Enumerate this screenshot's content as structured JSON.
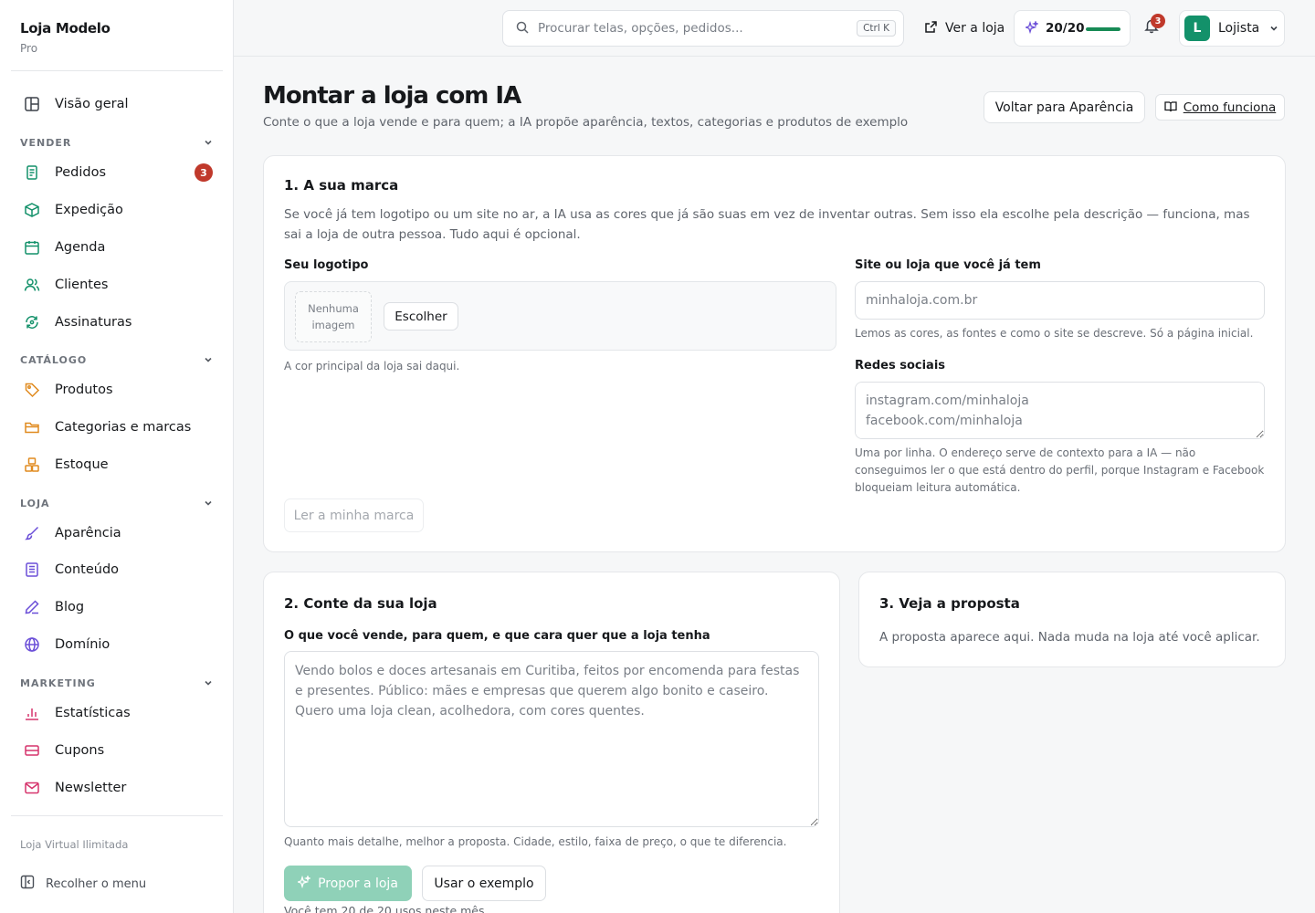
{
  "brand": {
    "name": "Loja Modelo",
    "plan": "Pro"
  },
  "sidebar": {
    "overview": {
      "label": "Visão geral",
      "icon": "layout-icon"
    },
    "sections": [
      {
        "label": "VENDER",
        "items": [
          {
            "label": "Pedidos",
            "icon": "receipt-icon",
            "badge": "3"
          },
          {
            "label": "Expedição",
            "icon": "box-icon"
          },
          {
            "label": "Agenda",
            "icon": "calendar-icon"
          },
          {
            "label": "Clientes",
            "icon": "users-icon"
          },
          {
            "label": "Assinaturas",
            "icon": "refresh-icon"
          }
        ]
      },
      {
        "label": "CATÁLOGO",
        "items": [
          {
            "label": "Produtos",
            "icon": "tag-icon"
          },
          {
            "label": "Categorias e marcas",
            "icon": "folder-icon"
          },
          {
            "label": "Estoque",
            "icon": "boxes-icon"
          }
        ]
      },
      {
        "label": "LOJA",
        "items": [
          {
            "label": "Aparência",
            "icon": "brush-icon"
          },
          {
            "label": "Conteúdo",
            "icon": "document-icon"
          },
          {
            "label": "Blog",
            "icon": "pen-icon"
          },
          {
            "label": "Domínio",
            "icon": "globe-icon"
          }
        ]
      },
      {
        "label": "MARKETING",
        "items": [
          {
            "label": "Estatísticas",
            "icon": "bar-chart-icon"
          },
          {
            "label": "Cupons",
            "icon": "ticket-icon"
          },
          {
            "label": "Newsletter",
            "icon": "mail-icon"
          }
        ]
      }
    ],
    "footer_plan": "Loja Virtual Ilimitada",
    "collapse_label": "Recolher o menu"
  },
  "topbar": {
    "search_placeholder": "Procurar telas, opções, pedidos...",
    "search_shortcut": "Ctrl K",
    "view_store": "Ver a loja",
    "usage_label": "20/20",
    "usage_fraction": 1.0,
    "notifications_count": "3",
    "account_initial": "L",
    "account_name": "Lojista"
  },
  "page": {
    "title": "Montar a loja com IA",
    "subtitle": "Conte o que a loja vende e para quem; a IA propõe aparência, textos, categorias e produtos de exemplo",
    "back_button": "Voltar para Aparência",
    "how_button": "Como funciona"
  },
  "brand_card": {
    "title": "1. A sua marca",
    "intro": "Se você já tem logotipo ou um site no ar, a IA usa as cores que já são suas em vez de inventar outras. Sem isso ela escolhe pela descrição — funciona, mas sai a loja de outra pessoa. Tudo aqui é opcional.",
    "logo_label": "Seu logotipo",
    "logo_empty": "Nenhuma imagem",
    "choose_button": "Escolher",
    "logo_hint": "A cor principal da loja sai daqui.",
    "site_label": "Site ou loja que você já tem",
    "site_placeholder": "minhaloja.com.br",
    "site_hint": "Lemos as cores, as fontes e como o site se descreve. Só a página inicial.",
    "social_label": "Redes sociais",
    "social_placeholder": "instagram.com/minhaloja\nfacebook.com/minhaloja",
    "social_hint": "Uma por linha. O endereço serve de contexto para a IA — não conseguimos ler o que está dentro do perfil, porque Instagram e Facebook bloqueiam leitura automática.",
    "read_button": "Ler a minha marca"
  },
  "store_card": {
    "title": "2. Conte da sua loja",
    "question_label": "O que você vende, para quem, e que cara quer que a loja tenha",
    "description_placeholder": "Vendo bolos e doces artesanais em Curitiba, feitos por encomenda para festas e presentes. Público: mães e empresas que querem algo bonito e caseiro. Quero uma loja clean, acolhedora, com cores quentes.",
    "hint": "Quanto mais detalhe, melhor a proposta. Cidade, estilo, faixa de preço, o que te diferencia.",
    "propose_button": "Propor a loja",
    "example_button": "Usar o exemplo",
    "usage_note": "Você tem 20 de 20 usos neste mês."
  },
  "proposal_card": {
    "title": "3. Veja a proposta",
    "text": "A proposta aparece aqui. Nada muda na loja até você aplicar."
  },
  "colors": {
    "accent": "#13916a",
    "badge": "#c0392b",
    "propose_disabled": "#8fd1b8"
  }
}
